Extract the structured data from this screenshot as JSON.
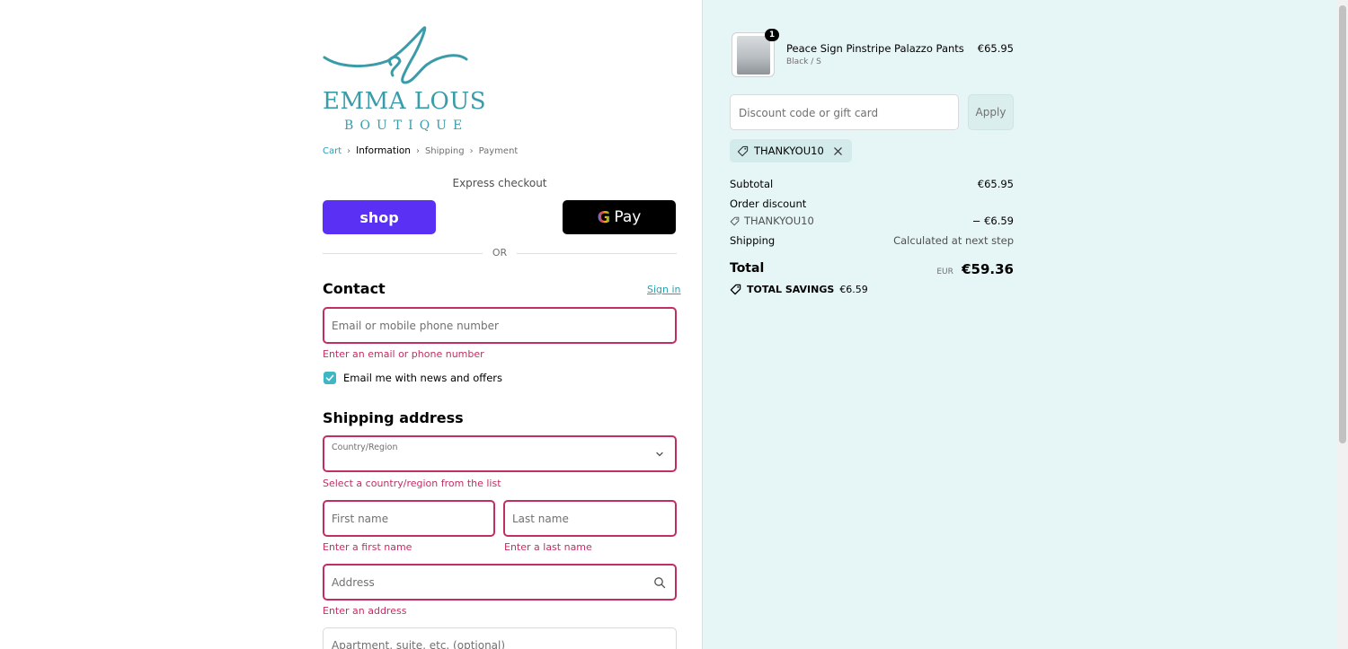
{
  "brand": {
    "name": "EMMA LOUS",
    "sub": "BOUTIQUE",
    "accent": "#3a9ca9"
  },
  "breadcrumb": {
    "cart": "Cart",
    "information": "Information",
    "shipping": "Shipping",
    "payment": "Payment"
  },
  "express": {
    "label": "Express checkout",
    "shop_label": "shop",
    "gpay_label": "Pay",
    "or": "OR"
  },
  "contact": {
    "title": "Contact",
    "sign_in": "Sign in",
    "email_placeholder": "Email or mobile phone number",
    "email_error": "Enter an email or phone number",
    "news_label": "Email me with news and offers",
    "news_checked": true
  },
  "shipping": {
    "title": "Shipping address",
    "country_label": "Country/Region",
    "country_error": "Select a country/region from the list",
    "first_name_placeholder": "First name",
    "first_name_error": "Enter a first name",
    "last_name_placeholder": "Last name",
    "last_name_error": "Enter a last name",
    "address_placeholder": "Address",
    "address_error": "Enter an address",
    "apartment_placeholder": "Apartment, suite, etc. (optional)"
  },
  "order": {
    "item": {
      "name": "Peace Sign Pinstripe Palazzo Pants",
      "variant": "Black / S",
      "price": "€65.95",
      "quantity": "1"
    },
    "discount_placeholder": "Discount code or gift card",
    "apply_label": "Apply",
    "applied_code": "THANKYOU10",
    "subtotal_label": "Subtotal",
    "subtotal_value": "€65.95",
    "order_discount_label": "Order discount",
    "discount_code": "THANKYOU10",
    "discount_value": "− €6.59",
    "shipping_label": "Shipping",
    "shipping_value": "Calculated at next step",
    "total_label": "Total",
    "currency": "EUR",
    "total_value": "€59.36",
    "savings_label": "TOTAL SAVINGS",
    "savings_value": "€6.59"
  },
  "colors": {
    "error": "#c12e63",
    "link": "#2a9fb1",
    "shop": "#5a31f4",
    "summary_bg": "#e6f5f5"
  }
}
